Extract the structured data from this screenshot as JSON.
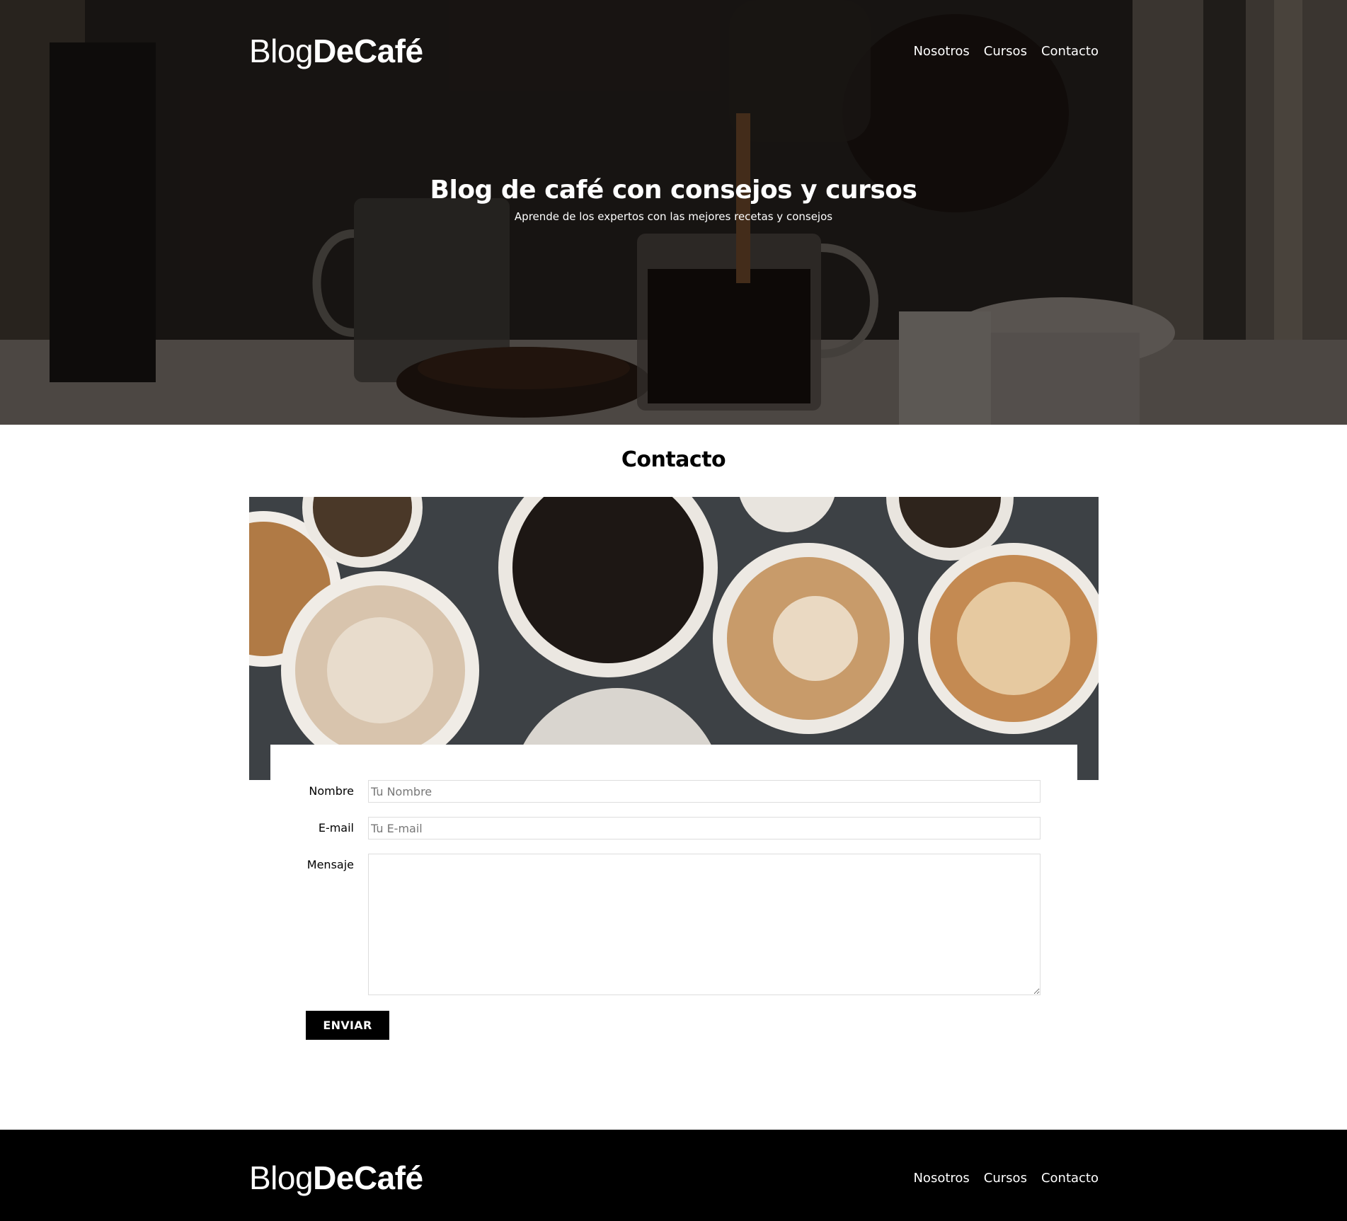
{
  "header": {
    "logo_light": "Blog",
    "logo_bold": "DeCafé",
    "nav": [
      {
        "label": "Nosotros"
      },
      {
        "label": "Cursos"
      },
      {
        "label": "Contacto"
      }
    ]
  },
  "hero": {
    "title": "Blog de café con consejos y cursos",
    "subtitle": "Aprende de los expertos con las mejores recetas y consejos"
  },
  "contact": {
    "title": "Contacto",
    "form": {
      "name_label": "Nombre",
      "name_placeholder": "Tu Nombre",
      "email_label": "E-mail",
      "email_placeholder": "Tu E-mail",
      "message_label": "Mensaje",
      "submit_label": "ENVIAR"
    }
  },
  "footer": {
    "logo_light": "Blog",
    "logo_bold": "DeCafé",
    "nav": [
      {
        "label": "Nosotros"
      },
      {
        "label": "Cursos"
      },
      {
        "label": "Contacto"
      }
    ]
  },
  "colors": {
    "footer_bg": "#000000",
    "button_bg": "#000000",
    "hero_text": "#ffffff"
  }
}
